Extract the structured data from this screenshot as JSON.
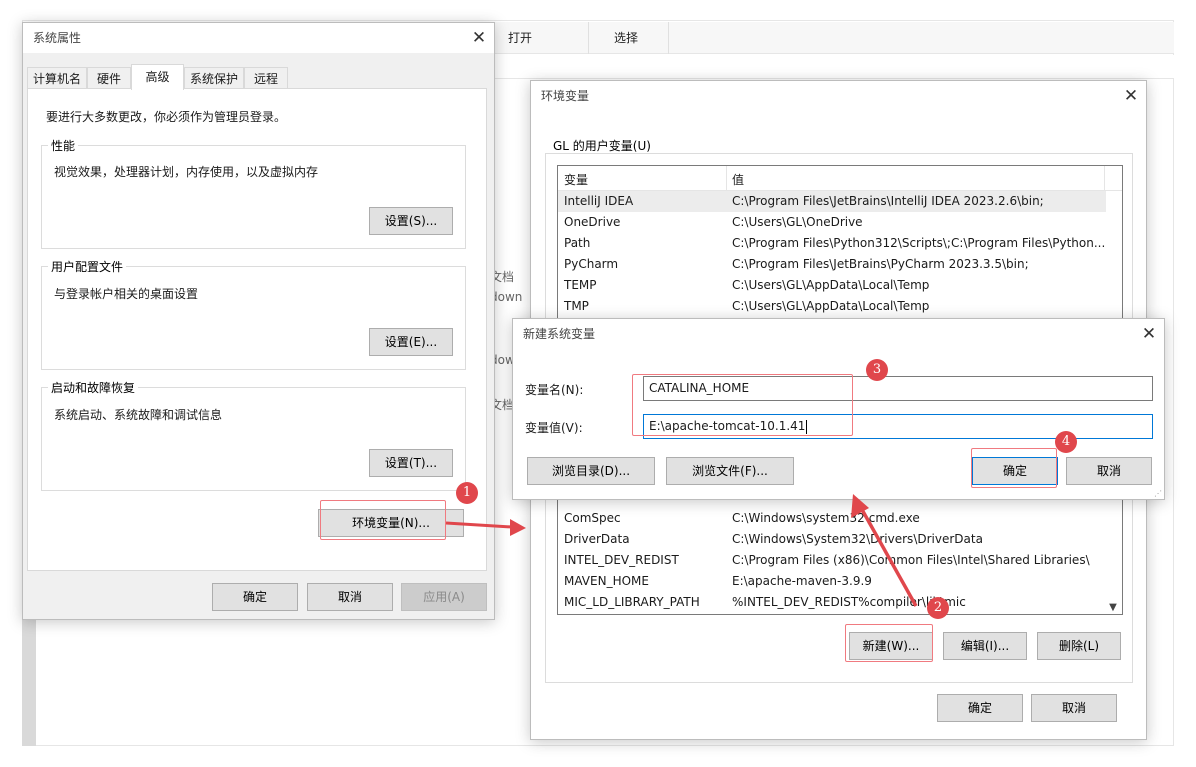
{
  "background": {
    "toolbar": {
      "open": "打开",
      "select": "选择"
    },
    "fragments": [
      "文档",
      "down",
      "dow",
      "文档"
    ]
  },
  "sysprops": {
    "title": "系统属性",
    "tabs": [
      "计算机名",
      "硬件",
      "高级",
      "系统保护",
      "远程"
    ],
    "notice": "要进行大多数更改，你必须作为管理员登录。",
    "performance": {
      "label": "性能",
      "desc": "视觉效果，处理器计划，内存使用，以及虚拟内存",
      "button": "设置(S)..."
    },
    "profile": {
      "label": "用户配置文件",
      "desc": "与登录帐户相关的桌面设置",
      "button": "设置(E)..."
    },
    "startup": {
      "label": "启动和故障恢复",
      "desc": "系统启动、系统故障和调试信息",
      "button": "设置(T)..."
    },
    "env_button": "环境变量(N)...",
    "ok": "确定",
    "cancel": "取消",
    "apply": "应用(A)"
  },
  "envvars": {
    "title": "环境变量",
    "user_group": "GL 的用户变量(U)",
    "columns": [
      "变量",
      "值"
    ],
    "user_rows": [
      {
        "name": "IntelliJ IDEA",
        "value": "C:\\Program Files\\JetBrains\\IntelliJ IDEA 2023.2.6\\bin;"
      },
      {
        "name": "OneDrive",
        "value": "C:\\Users\\GL\\OneDrive"
      },
      {
        "name": "Path",
        "value": "C:\\Program Files\\Python312\\Scripts\\;C:\\Program Files\\Python..."
      },
      {
        "name": "PyCharm",
        "value": "C:\\Program Files\\JetBrains\\PyCharm 2023.3.5\\bin;"
      },
      {
        "name": "TEMP",
        "value": "C:\\Users\\GL\\AppData\\Local\\Temp"
      },
      {
        "name": "TMP",
        "value": "C:\\Users\\GL\\AppData\\Local\\Temp"
      }
    ],
    "system_rows": [
      {
        "name": "ComSpec",
        "value": "C:\\Windows\\system32\\cmd.exe"
      },
      {
        "name": "DriverData",
        "value": "C:\\Windows\\System32\\Drivers\\DriverData"
      },
      {
        "name": "INTEL_DEV_REDIST",
        "value": "C:\\Program Files (x86)\\Common Files\\Intel\\Shared Libraries\\"
      },
      {
        "name": "MAVEN_HOME",
        "value": "E:\\apache-maven-3.9.9"
      },
      {
        "name": "MIC_LD_LIBRARY_PATH",
        "value": "%INTEL_DEV_REDIST%compiler\\lib\\mic"
      }
    ],
    "new_button": "新建(W)...",
    "edit_button": "编辑(I)...",
    "delete_button": "删除(L)",
    "ok": "确定",
    "cancel": "取消"
  },
  "newvar": {
    "title": "新建系统变量",
    "name_label": "变量名(N):",
    "name_value": "CATALINA_HOME",
    "value_label": "变量值(V):",
    "value_value": "E:\\apache-tomcat-10.1.41",
    "browse_dir": "浏览目录(D)...",
    "browse_file": "浏览文件(F)...",
    "ok": "确定",
    "cancel": "取消"
  },
  "badges": [
    "1",
    "2",
    "3",
    "4"
  ],
  "accent": "#e0474c",
  "focus_color": "#0078d7"
}
